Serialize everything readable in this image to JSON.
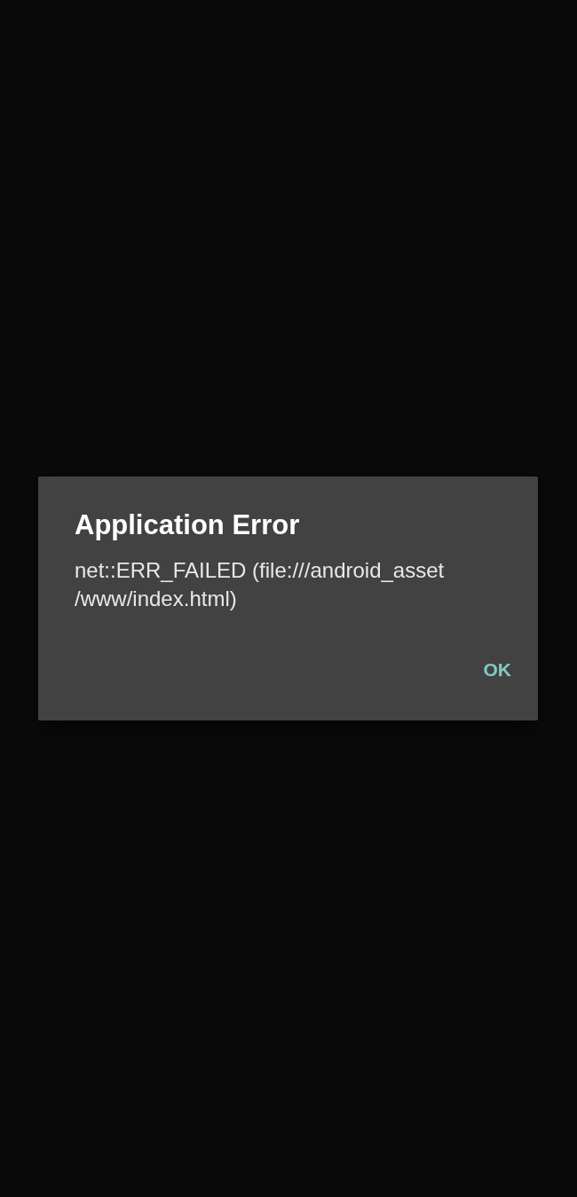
{
  "dialog": {
    "title": "Application Error",
    "message_lines": [
      "net::ERR_FAILED (file:///android_asset",
      "/www/index.html)"
    ],
    "buttons": [
      "OK"
    ]
  }
}
